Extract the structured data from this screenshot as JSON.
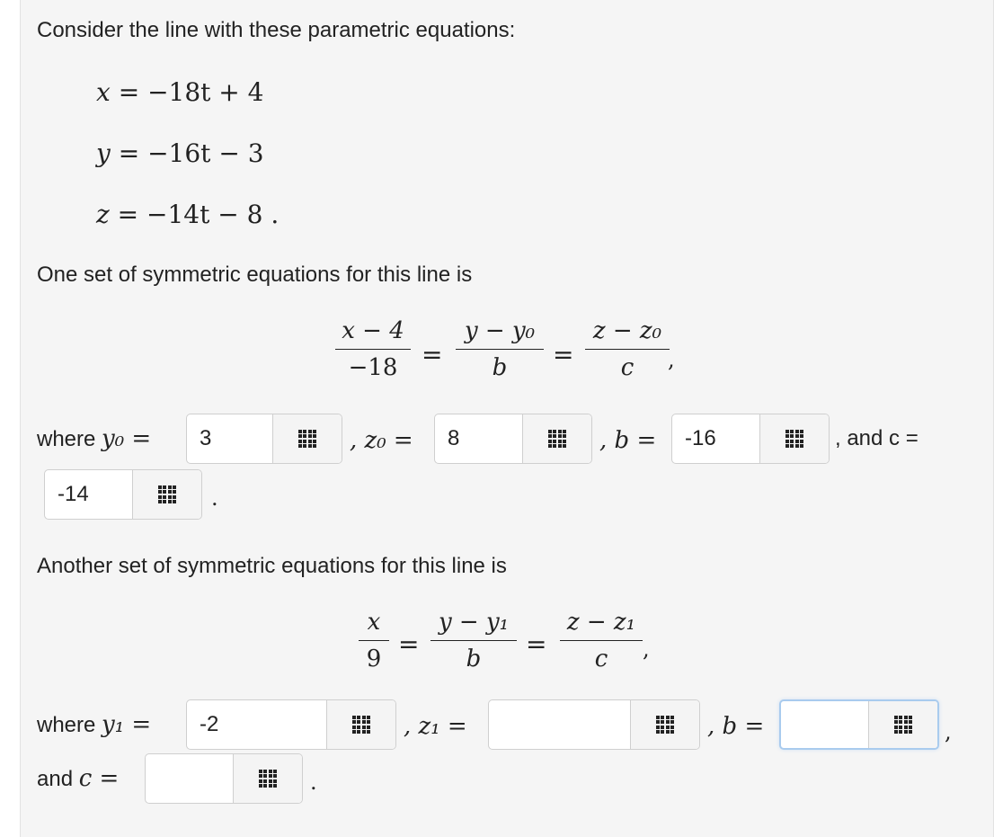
{
  "intro": "Consider the line with these parametric equations:",
  "param": {
    "x": {
      "var": "x",
      "rhs": "= −18t + 4"
    },
    "y": {
      "var": "y",
      "rhs": "= −16t − 3"
    },
    "z": {
      "var": "z",
      "rhs": "= −14t − 8 ."
    }
  },
  "set1": {
    "heading": "One set of symmetric equations for this line is",
    "frac1": {
      "num": "x − 4",
      "den": "−18"
    },
    "frac2": {
      "num": "y − y₀",
      "den": "b"
    },
    "frac3": {
      "num": "z − z₀",
      "den": "c"
    },
    "equals": "=",
    "trailing": ",",
    "where_label": "where",
    "y0_label": "y₀ =",
    "z0_label": ", z₀ =",
    "b_label": ", b =",
    "c_label": ", and c =",
    "y0_value": "3",
    "z0_value": "8",
    "b_value": "-16",
    "c_value": "-14",
    "end": "."
  },
  "set2": {
    "heading": "Another set of symmetric equations for this line is",
    "frac1": {
      "num": "x",
      "den": "9"
    },
    "frac2": {
      "num": "y − y₁",
      "den": "b"
    },
    "frac3": {
      "num": "z − z₁",
      "den": "c"
    },
    "equals": "=",
    "trailing": ",",
    "where_label": "where",
    "y1_label": "y₁ =",
    "z1_label": ", z₁ =",
    "b_label": ", b =",
    "after_b": ",",
    "c_prefix": "and",
    "c_label": "c =",
    "y1_value": "-2",
    "z1_value": "",
    "b_value": "",
    "c_value": "",
    "end": "."
  },
  "icons": {
    "keypad": "keypad-grid-icon"
  }
}
